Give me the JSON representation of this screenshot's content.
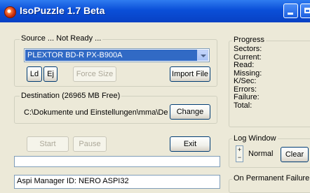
{
  "window": {
    "title": "IsoPuzzle 1.7 Beta"
  },
  "source": {
    "label": "Source ... Not Ready ...",
    "drive_selected": "PLEXTOR BD-R  PX-B900A",
    "ld_label": "Ld",
    "ej_label": "Ej",
    "force_size_label": "Force Size",
    "import_file_label": "Import File"
  },
  "destination": {
    "label": "Destination  (26965 MB Free)",
    "path": "C:\\Dokumente und Einstellungen\\mma\\Des",
    "change_label": "Change"
  },
  "actions": {
    "start_label": "Start",
    "pause_label": "Pause",
    "exit_label": "Exit"
  },
  "log": {
    "first_line": "Aspi Manager ID: NERO ASPI32"
  },
  "progress": {
    "label": "Progress",
    "fields": [
      "Sectors:",
      "Current:",
      "Read:",
      "Missing:",
      "K/Sec:",
      "Errors:",
      "Failure:",
      "Total:"
    ]
  },
  "log_window": {
    "label": "Log Window",
    "level": "Normal",
    "clear_label": "Clear"
  },
  "permanent_failure": {
    "label": "On Permanent Failure"
  }
}
